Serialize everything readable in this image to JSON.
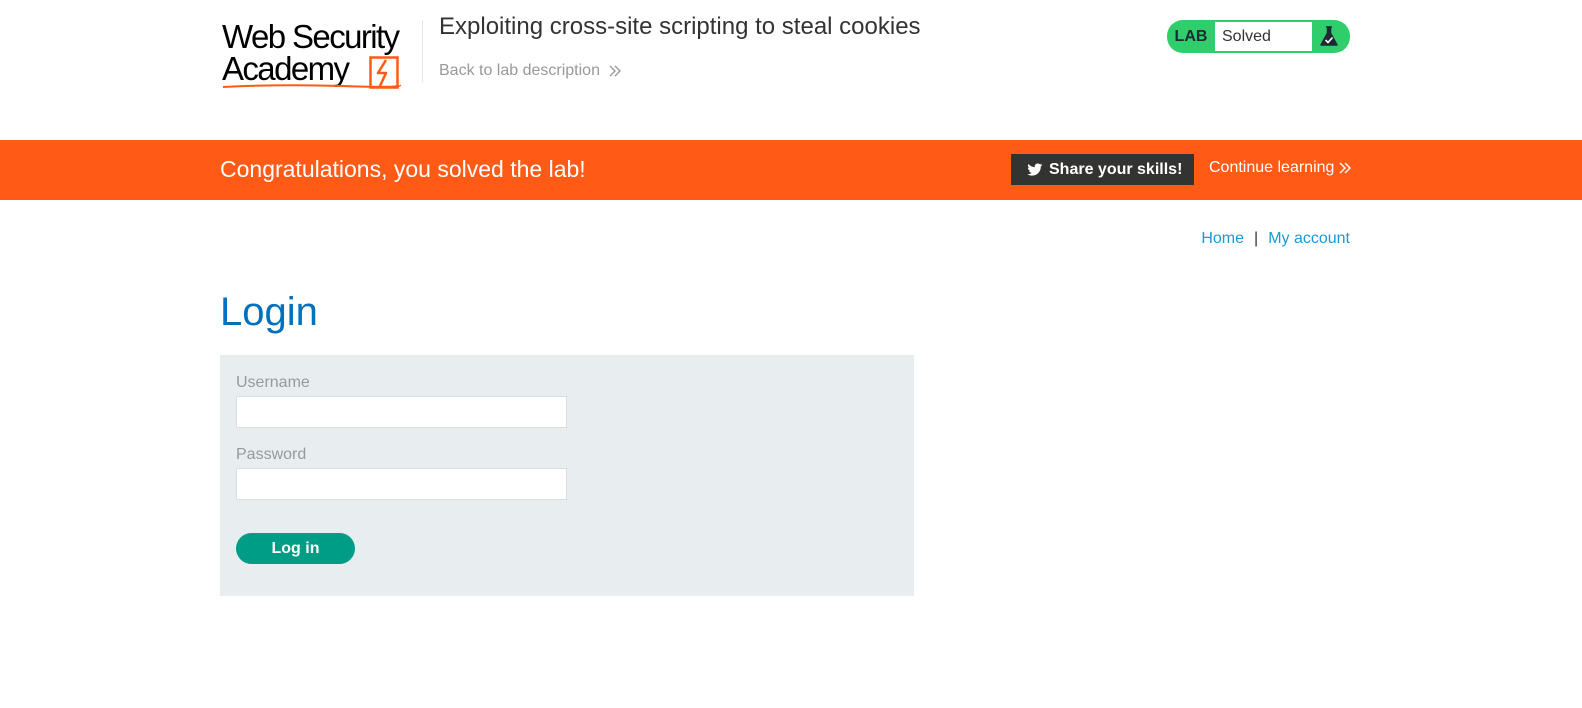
{
  "academy_header": {
    "logo_line1": "Web Security",
    "logo_line2": "Academy",
    "lab_title": "Exploiting cross-site scripting to steal cookies",
    "back_link": "Back to lab description",
    "lab_status": {
      "tag": "LAB",
      "status": "Solved"
    }
  },
  "banner": {
    "message": "Congratulations, you solved the lab!",
    "share_button": "Share your skills!",
    "continue_link": "Continue learning"
  },
  "top_links": {
    "home": "Home",
    "separator": "|",
    "my_account": "My account"
  },
  "login": {
    "heading": "Login",
    "username_label": "Username",
    "username_value": "",
    "password_label": "Password",
    "password_value": "",
    "submit_label": "Log in"
  },
  "icons": {
    "logo_bolt": "lightning-bolt-icon",
    "back_chevrons": "double-chevron-right-icon",
    "lab_flask": "flask-icon",
    "twitter": "twitter-bird-icon",
    "continue_chevrons": "double-chevron-right-icon"
  },
  "colors": {
    "brand_orange": "#ff5a16",
    "solved_green": "#2fcd6b",
    "link_blue": "#1a9ad9",
    "heading_blue": "#0071bc",
    "button_teal": "#009d86",
    "form_background": "#e8eef0"
  }
}
